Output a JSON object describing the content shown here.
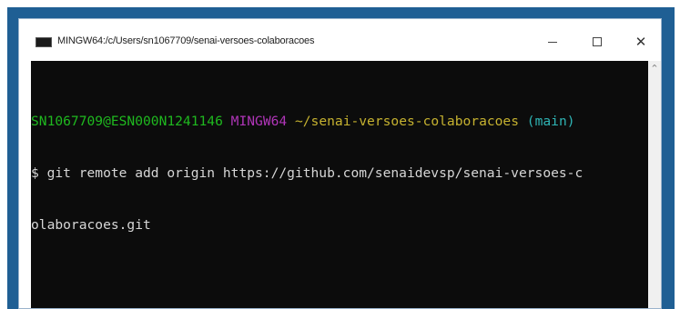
{
  "window": {
    "title": "MINGW64:/c/Users/sn1067709/senai-versoes-colaboracoes",
    "icon": "terminal-icon",
    "controls": {
      "minimize": "minimize-icon",
      "maximize": "maximize-icon",
      "close_glyph": "✕"
    }
  },
  "terminal": {
    "prompt": {
      "user_host": "SN1067709@ESN000N1241146",
      "system": "MINGW64",
      "path": "~/senai-versoes-colaboracoes",
      "branch": "(main)"
    },
    "command_line_1": "$ git remote add origin https://github.com/senaidevsp/senai-versoes-c",
    "command_line_2": "olaboracoes.git"
  },
  "scrollbar": {
    "up_arrow": "^"
  },
  "colors": {
    "desktop_background": "#1f5f94",
    "terminal_background": "#0c0c0c",
    "prompt_user_host": "#1fb91f",
    "prompt_system": "#b035b8",
    "prompt_path": "#c6b230",
    "prompt_branch": "#2fb4b4",
    "text": "#d6d6d6"
  }
}
